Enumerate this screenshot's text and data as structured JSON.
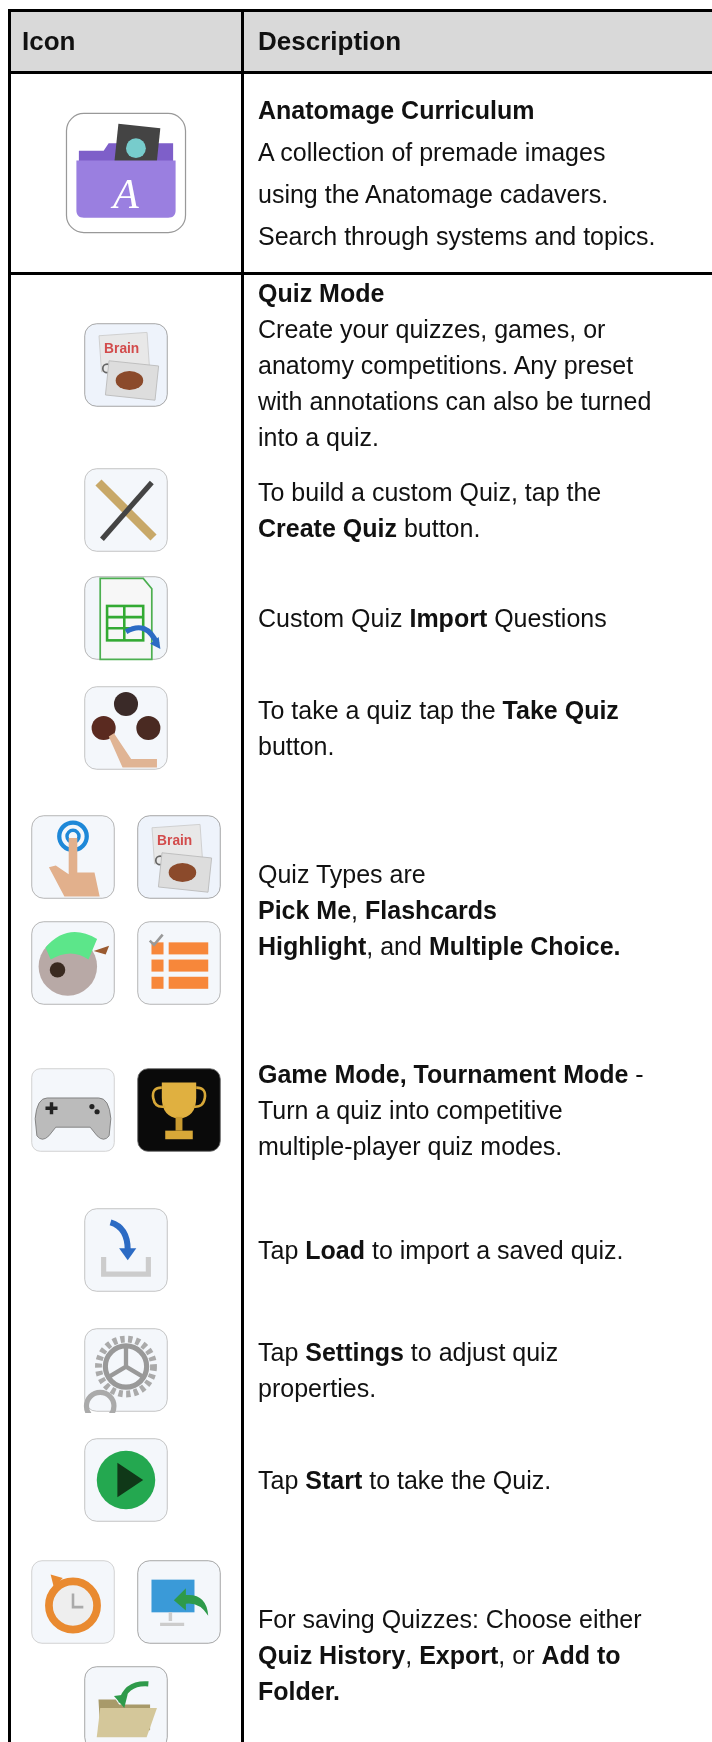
{
  "table": {
    "columns": [
      "Icon",
      "Description"
    ],
    "rows": [
      {
        "entries": [
          {
            "icons": [
              [
                {
                  "kind": "curriculum",
                  "label": "A"
                }
              ]
            ],
            "title": "Anatomage Curriculum",
            "paragraphs": [
              "A collection of premade images\nusing the Anatomage cadavers.\nSearch through systems and topics."
            ]
          }
        ]
      },
      {
        "entries": [
          {
            "icons": [
              [
                {
                  "kind": "flashcards",
                  "label": "Brain"
                }
              ]
            ],
            "title": "Quiz Mode",
            "paragraphs": [
              "Create your quizzes, games, or\nanatomy competitions. Any preset\nwith annotations can also be turned\ninto a quiz."
            ]
          },
          {
            "icons": [
              [
                {
                  "kind": "pen-ruler"
                }
              ]
            ],
            "paragraphs": [
              "To build a custom Quiz, tap the\n**Create Quiz** button."
            ]
          },
          {
            "icons": [
              [
                {
                  "kind": "import"
                }
              ]
            ],
            "paragraphs": [
              "Custom Quiz **Import** Questions"
            ]
          },
          {
            "icons": [
              [
                {
                  "kind": "take-quiz"
                }
              ]
            ],
            "paragraphs": [
              "To take a quiz tap the **Take Quiz**\nbutton."
            ]
          },
          {
            "icons": [
              [
                {
                  "kind": "tap"
                },
                {
                  "kind": "flashcards",
                  "label": "Brain"
                }
              ],
              [
                {
                  "kind": "eye"
                },
                {
                  "kind": "list"
                }
              ]
            ],
            "paragraphs": [
              "Quiz Types are\n**Pick Me**, **Flashcards**\n**Highlight**, and **Multiple Choice.**"
            ]
          },
          {
            "icons": [
              [
                {
                  "kind": "gamepad"
                },
                {
                  "kind": "trophy"
                }
              ]
            ],
            "paragraphs": [
              "**Game Mode, Tournament Mode** -\nTurn a quiz into competitive\nmultiple-player quiz modes."
            ]
          },
          {
            "icons": [
              [
                {
                  "kind": "load"
                }
              ]
            ],
            "paragraphs": [
              "Tap **Load** to import a saved quiz."
            ]
          },
          {
            "icons": [
              [
                {
                  "kind": "gears"
                }
              ]
            ],
            "paragraphs": [
              "Tap **Settings** to adjust quiz\nproperties."
            ]
          },
          {
            "icons": [
              [
                {
                  "kind": "play"
                }
              ]
            ],
            "paragraphs": [
              "Tap **Start** to take the Quiz."
            ]
          },
          {
            "icons": [
              [
                {
                  "kind": "history"
                },
                {
                  "kind": "export"
                }
              ],
              [
                {
                  "kind": "folder"
                }
              ]
            ],
            "paragraphs": [
              "For saving Quizzes: Choose either\n**Quiz History**, **Export**, or **Add to**\n**Folder.**"
            ]
          }
        ]
      }
    ]
  }
}
